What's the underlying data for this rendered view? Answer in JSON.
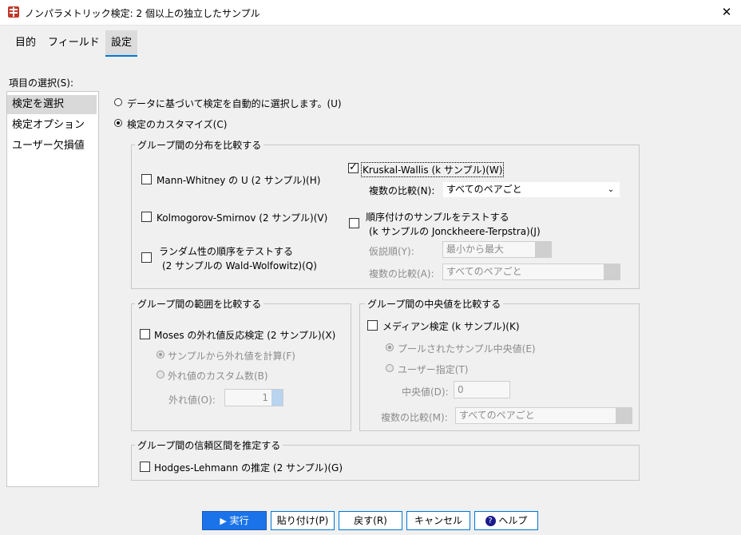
{
  "window": {
    "title": "ノンパラメトリック検定: 2 個以上の独立したサンプル",
    "close_glyph": "✕"
  },
  "tabs": [
    {
      "label": "目的"
    },
    {
      "label": "フィールド"
    },
    {
      "label": "設定"
    }
  ],
  "left_panel": {
    "label": "項目の選択(S):",
    "items": [
      {
        "label": "検定を選択"
      },
      {
        "label": "検定オプション"
      },
      {
        "label": "ユーザー欠損値"
      }
    ]
  },
  "mode": {
    "auto_label": "データに基づいて検定を自動的に選択します。(U)",
    "custom_label": "検定のカスタマイズ(C)"
  },
  "distribution_group": {
    "title": "グループ間の分布を比較する",
    "mann_whitney": "Mann-Whitney の U (2 サンプル)(H)",
    "kolmogorov": "Kolmogorov-Smirnov (2 サンプル)(V)",
    "randomness_line1": "ランダム性の順序をテストする",
    "randomness_line2": "(2 サンプルの Wald-Wolfowitz)(Q)",
    "kruskal": "Kruskal-Wallis (k サンプル)(W)",
    "multiple_label": "複数の比較(N):",
    "multiple_value": "すべてのペアごと",
    "ordered_line1": "順序付けのサンプルをテストする",
    "ordered_line2": "(k サンプルの Jonckheere-Terpstra)(J)",
    "hypothesis_label": "仮説順(Y):",
    "hypothesis_value": "最小から最大",
    "multiple2_label": "複数の比較(A):",
    "multiple2_value": "すべてのペアごと"
  },
  "range_group": {
    "title": "グループ間の範囲を比較する",
    "moses": "Moses の外れ値反応検定 (2 サンプル)(X)",
    "compute_outliers": "サンプルから外れ値を計算(F)",
    "custom_outliers": "外れ値のカスタム数(B)",
    "outliers_label": "外れ値(O):",
    "outliers_value": "1"
  },
  "median_group": {
    "title": "グループ間の中央値を比較する",
    "median_test": "メディアン検定 (k サンプル)(K)",
    "pooled": "プールされたサンプル中央値(E)",
    "user_specified": "ユーザー指定(T)",
    "median_label": "中央値(D):",
    "median_value": "0",
    "multiple_label": "複数の比較(M):",
    "multiple_value": "すべてのペアごと"
  },
  "ci_group": {
    "title": "グループ間の信頼区間を推定する",
    "hodges": "Hodges-Lehmann の推定 (2 サンプル)(G)"
  },
  "buttons": {
    "run": "実行",
    "paste": "貼り付け(P)",
    "reset": "戻す(R)",
    "cancel": "キャンセル",
    "help": "ヘルプ"
  }
}
